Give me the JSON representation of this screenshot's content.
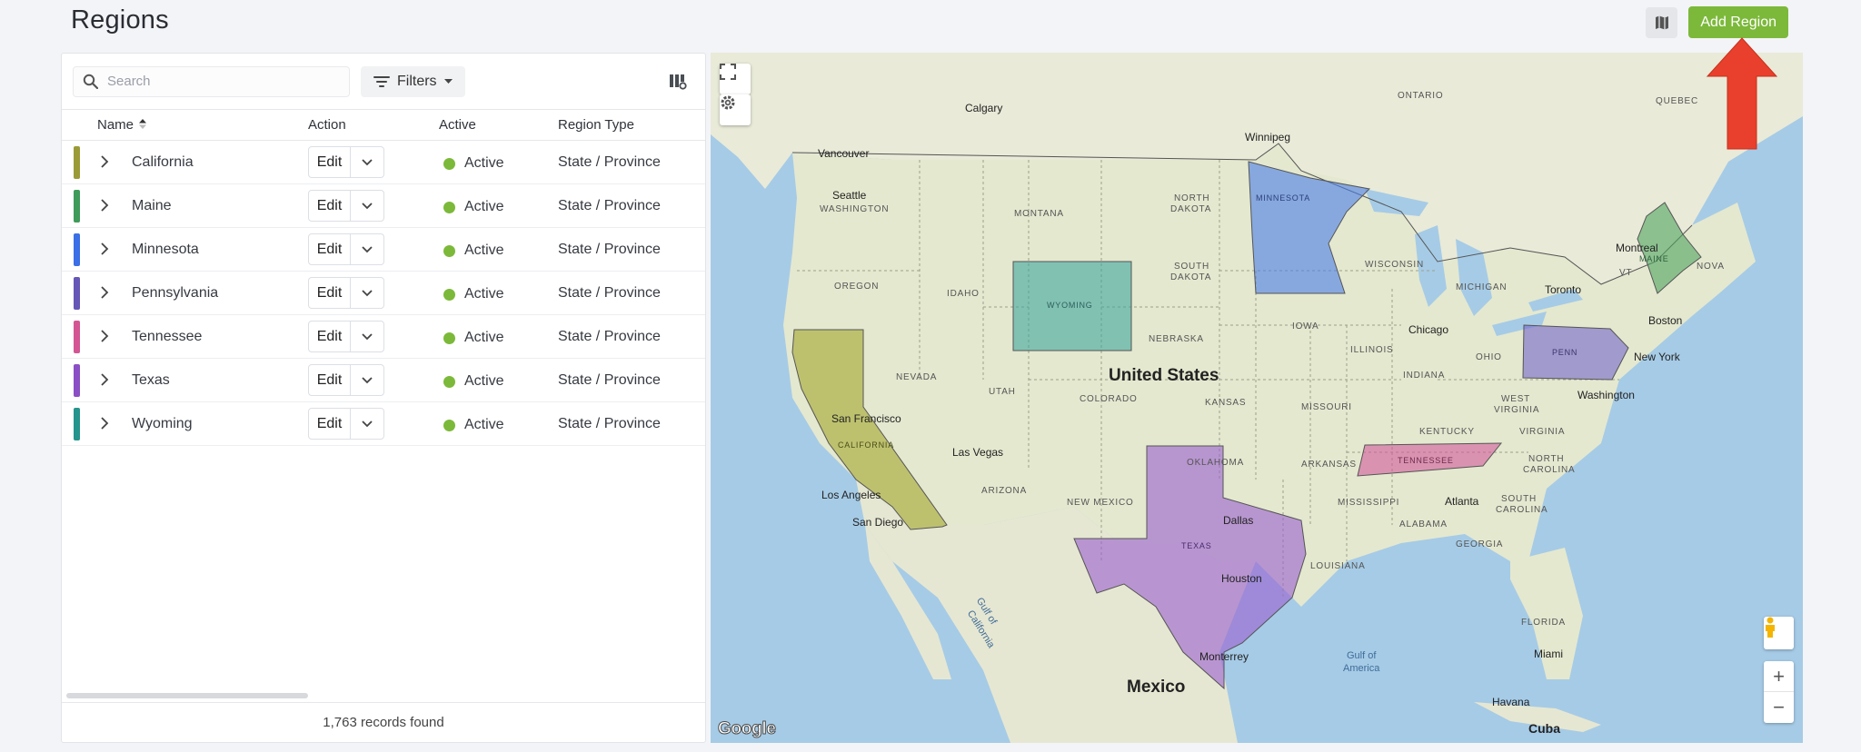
{
  "page": {
    "title": "Regions"
  },
  "toolbar": {
    "add_label": "Add Region",
    "map_toggle_icon": "map-icon"
  },
  "search": {
    "placeholder": "Search"
  },
  "filters": {
    "label": "Filters"
  },
  "table": {
    "columns": {
      "name": "Name",
      "action": "Action",
      "active": "Active",
      "type": "Region Type"
    },
    "rows": [
      {
        "name": "California",
        "color": "#9a9b36",
        "action": "Edit",
        "status": "Active",
        "type": "State / Province"
      },
      {
        "name": "Maine",
        "color": "#3f9b5a",
        "action": "Edit",
        "status": "Active",
        "type": "State / Province"
      },
      {
        "name": "Minnesota",
        "color": "#3a6fe6",
        "action": "Edit",
        "status": "Active",
        "type": "State / Province"
      },
      {
        "name": "Pennsylvania",
        "color": "#6656b6",
        "action": "Edit",
        "status": "Active",
        "type": "State / Province"
      },
      {
        "name": "Tennessee",
        "color": "#d35593",
        "action": "Edit",
        "status": "Active",
        "type": "State / Province"
      },
      {
        "name": "Texas",
        "color": "#8a4fc4",
        "action": "Edit",
        "status": "Active",
        "type": "State / Province"
      },
      {
        "name": "Wyoming",
        "color": "#25948c",
        "action": "Edit",
        "status": "Active",
        "type": "State / Province"
      }
    ],
    "footer": "1,763 records found"
  },
  "map": {
    "country_labels": {
      "us": "United States",
      "mexico": "Mexico"
    },
    "cities": {
      "calgary": "Calgary",
      "winnipeg": "Winnipeg",
      "vancouver": "Vancouver",
      "seattle": "Seattle",
      "montreal": "Montreal",
      "toronto": "Toronto",
      "boston": "Boston",
      "new_york": "New York",
      "chicago": "Chicago",
      "washington": "Washington",
      "san_francisco": "San Francisco",
      "las_vegas": "Las Vegas",
      "los_angeles": "Los Angeles",
      "san_diego": "San Diego",
      "dallas": "Dallas",
      "houston": "Houston",
      "atlanta": "Atlanta",
      "monterrey": "Monterrey",
      "miami": "Miami",
      "havana": "Havana",
      "cuba": "Cuba"
    },
    "regions_labels": {
      "ontario": "ONTARIO",
      "quebec": "QUEBEC",
      "washington": "WASHINGTON",
      "montana": "MONTANA",
      "north_dakota_1": "NORTH",
      "north_dakota_2": "DAKOTA",
      "south_dakota_1": "SOUTH",
      "south_dakota_2": "DAKOTA",
      "oregon": "OREGON",
      "idaho": "IDAHO",
      "wyoming": "WYOMING",
      "minnesota": "MINNESOTA",
      "wisconsin": "WISCONSIN",
      "michigan": "MICHIGAN",
      "maine": "MAINE",
      "iowa": "IOWA",
      "nebraska": "NEBRASKA",
      "illinois": "ILLINOIS",
      "indiana": "INDIANA",
      "ohio": "OHIO",
      "penn": "PENN",
      "nevada": "NEVADA",
      "utah": "UTAH",
      "colorado": "COLORADO",
      "kansas": "KANSAS",
      "missouri": "MISSOURI",
      "kentucky": "KENTUCKY",
      "west_virginia_1": "WEST",
      "west_virginia_2": "VIRGINIA",
      "virginia": "VIRGINIA",
      "tennessee": "TENNESSEE",
      "north_carolina_1": "NORTH",
      "north_carolina_2": "CAROLINA",
      "california": "CALIFORNIA",
      "arizona": "ARIZONA",
      "new_mexico": "NEW MEXICO",
      "oklahoma": "OKLAHOMA",
      "arkansas": "ARKANSAS",
      "mississippi": "MISSISSIPPI",
      "alabama": "ALABAMA",
      "south_carolina_1": "SOUTH",
      "south_carolina_2": "CAROLINA",
      "georgia": "GEORGIA",
      "texas": "TEXAS",
      "louisiana": "LOUISIANA",
      "florida": "FLORIDA",
      "vt": "VT",
      "nova": "NOVA"
    },
    "water_labels": {
      "gulf_ca_1": "Gulf of",
      "gulf_ca_2": "California",
      "gulf_am_1": "Gulf of",
      "gulf_am_2": "America"
    },
    "attribution": "Google",
    "zoom_in": "+",
    "zoom_out": "−"
  },
  "colors": {
    "accent": "#7cb93a",
    "arrow": "#e8402c"
  }
}
